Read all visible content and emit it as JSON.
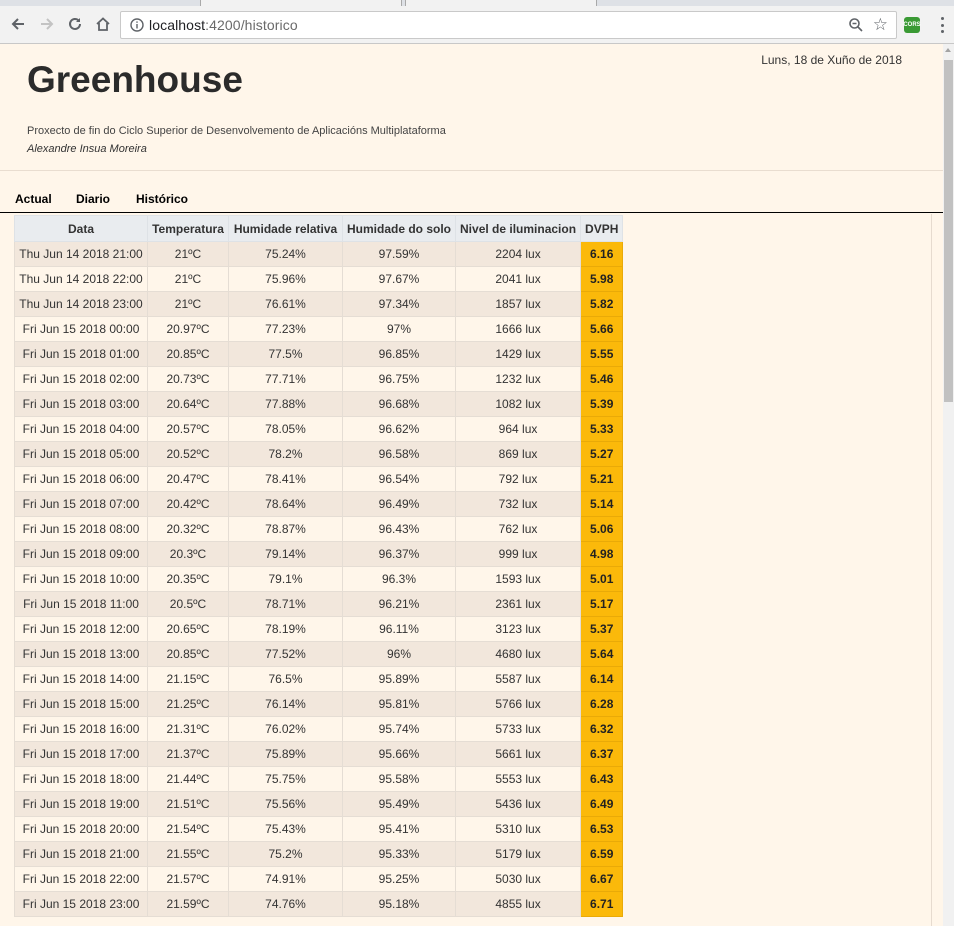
{
  "browser": {
    "url_host": "localhost",
    "url_path": ":4200/historico",
    "extension_label": "CORS"
  },
  "header": {
    "title": "Greenhouse",
    "date": "Luns, 18 de Xuño de 2018",
    "subtitle": "Proxecto de fin do Ciclo Superior de Desenvolvemento de Aplicacións Multiplataforma",
    "author": "Alexandre Insua Moreira"
  },
  "nav": {
    "items": [
      {
        "label": "Actual"
      },
      {
        "label": "Diario"
      },
      {
        "label": "Histórico"
      }
    ]
  },
  "table": {
    "headers": [
      "Data",
      "Temperatura",
      "Humidade relativa",
      "Humidade do solo",
      "Nivel de iluminacion",
      "DVPH"
    ],
    "rows": [
      [
        "Thu Jun 14 2018 21:00",
        "21ºC",
        "75.24%",
        "97.59%",
        "2204 lux",
        "6.16"
      ],
      [
        "Thu Jun 14 2018 22:00",
        "21ºC",
        "75.96%",
        "97.67%",
        "2041 lux",
        "5.98"
      ],
      [
        "Thu Jun 14 2018 23:00",
        "21ºC",
        "76.61%",
        "97.34%",
        "1857 lux",
        "5.82"
      ],
      [
        "Fri Jun 15 2018 00:00",
        "20.97ºC",
        "77.23%",
        "97%",
        "1666 lux",
        "5.66"
      ],
      [
        "Fri Jun 15 2018 01:00",
        "20.85ºC",
        "77.5%",
        "96.85%",
        "1429 lux",
        "5.55"
      ],
      [
        "Fri Jun 15 2018 02:00",
        "20.73ºC",
        "77.71%",
        "96.75%",
        "1232 lux",
        "5.46"
      ],
      [
        "Fri Jun 15 2018 03:00",
        "20.64ºC",
        "77.88%",
        "96.68%",
        "1082 lux",
        "5.39"
      ],
      [
        "Fri Jun 15 2018 04:00",
        "20.57ºC",
        "78.05%",
        "96.62%",
        "964 lux",
        "5.33"
      ],
      [
        "Fri Jun 15 2018 05:00",
        "20.52ºC",
        "78.2%",
        "96.58%",
        "869 lux",
        "5.27"
      ],
      [
        "Fri Jun 15 2018 06:00",
        "20.47ºC",
        "78.41%",
        "96.54%",
        "792 lux",
        "5.21"
      ],
      [
        "Fri Jun 15 2018 07:00",
        "20.42ºC",
        "78.64%",
        "96.49%",
        "732 lux",
        "5.14"
      ],
      [
        "Fri Jun 15 2018 08:00",
        "20.32ºC",
        "78.87%",
        "96.43%",
        "762 lux",
        "5.06"
      ],
      [
        "Fri Jun 15 2018 09:00",
        "20.3ºC",
        "79.14%",
        "96.37%",
        "999 lux",
        "4.98"
      ],
      [
        "Fri Jun 15 2018 10:00",
        "20.35ºC",
        "79.1%",
        "96.3%",
        "1593 lux",
        "5.01"
      ],
      [
        "Fri Jun 15 2018 11:00",
        "20.5ºC",
        "78.71%",
        "96.21%",
        "2361 lux",
        "5.17"
      ],
      [
        "Fri Jun 15 2018 12:00",
        "20.65ºC",
        "78.19%",
        "96.11%",
        "3123 lux",
        "5.37"
      ],
      [
        "Fri Jun 15 2018 13:00",
        "20.85ºC",
        "77.52%",
        "96%",
        "4680 lux",
        "5.64"
      ],
      [
        "Fri Jun 15 2018 14:00",
        "21.15ºC",
        "76.5%",
        "95.89%",
        "5587 lux",
        "6.14"
      ],
      [
        "Fri Jun 15 2018 15:00",
        "21.25ºC",
        "76.14%",
        "95.81%",
        "5766 lux",
        "6.28"
      ],
      [
        "Fri Jun 15 2018 16:00",
        "21.31ºC",
        "76.02%",
        "95.74%",
        "5733 lux",
        "6.32"
      ],
      [
        "Fri Jun 15 2018 17:00",
        "21.37ºC",
        "75.89%",
        "95.66%",
        "5661 lux",
        "6.37"
      ],
      [
        "Fri Jun 15 2018 18:00",
        "21.44ºC",
        "75.75%",
        "95.58%",
        "5553 lux",
        "6.43"
      ],
      [
        "Fri Jun 15 2018 19:00",
        "21.51ºC",
        "75.56%",
        "95.49%",
        "5436 lux",
        "6.49"
      ],
      [
        "Fri Jun 15 2018 20:00",
        "21.54ºC",
        "75.43%",
        "95.41%",
        "5310 lux",
        "6.53"
      ],
      [
        "Fri Jun 15 2018 21:00",
        "21.55ºC",
        "75.2%",
        "95.33%",
        "5179 lux",
        "6.59"
      ],
      [
        "Fri Jun 15 2018 22:00",
        "21.57ºC",
        "74.91%",
        "95.25%",
        "5030 lux",
        "6.67"
      ],
      [
        "Fri Jun 15 2018 23:00",
        "21.59ºC",
        "74.76%",
        "95.18%",
        "4855 lux",
        "6.71"
      ]
    ]
  },
  "colors": {
    "page_background": "#fff6ea",
    "row_alt": "#f2e7dc",
    "dvph_highlight": "#fbb90a"
  }
}
